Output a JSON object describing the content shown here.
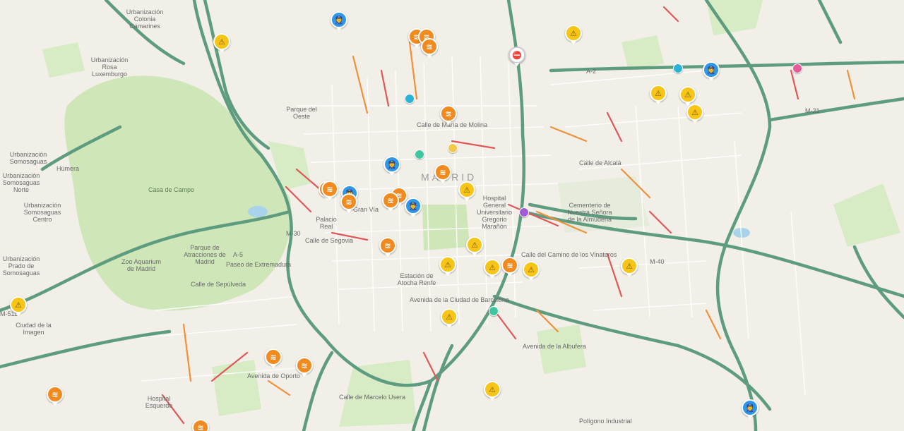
{
  "map": {
    "colors": {
      "land": "#f2efe9",
      "park": "#cfe6b8",
      "highway": "#5e9c7f",
      "jam_red": "#e05757",
      "jam_orange": "#f0913a",
      "street": "#ffffff"
    },
    "district_label": "MADRID",
    "labels": [
      {
        "id": "urb-colonia-camarines",
        "text": "Urbanización Colonia Camarines"
      },
      {
        "id": "urb-rosa-luxemburgo",
        "text": "Urbanización Rosa Luxemburgo"
      },
      {
        "id": "urb-somosaguas",
        "text": "Urbanización Somosaguas"
      },
      {
        "id": "humera",
        "text": "Húmera"
      },
      {
        "id": "urb-somosaguas-norte",
        "text": "Urbanización Somosaguas Norte"
      },
      {
        "id": "urb-somosaguas-centro",
        "text": "Urbanización Somosaguas Centro"
      },
      {
        "id": "urb-prado-somosaguas",
        "text": "Urbanización Prado de Somosaguas"
      },
      {
        "id": "ciudad-imagen",
        "text": "Ciudad de la Imagen"
      },
      {
        "id": "casa-campo",
        "text": "Casa de Campo"
      },
      {
        "id": "parque-atracciones",
        "text": "Parque de Atracciones de Madrid"
      },
      {
        "id": "zoo-aquarium",
        "text": "Zoo Aquarium de Madrid"
      },
      {
        "id": "palacio-real",
        "text": "Palacio Real"
      },
      {
        "id": "cementerio-almudena",
        "text": "Cementerio de Nuestra Señora de la Almudena"
      },
      {
        "id": "hospital-maranon",
        "text": "Hospital General Universitario Gregorio Marañón"
      },
      {
        "id": "estacion-atocha",
        "text": "Estación de Atocha Renfe"
      },
      {
        "id": "poligono-industrial",
        "text": "Polígono Industrial"
      },
      {
        "id": "calle-alcala",
        "text": "Calle de Alcalá"
      },
      {
        "id": "gran-via",
        "text": "Gran Vía"
      },
      {
        "id": "calle-segovia",
        "text": "Calle de Segovia"
      },
      {
        "id": "calle-sepulveda",
        "text": "Calle de Sepúlveda"
      },
      {
        "id": "paseo-extremadura",
        "text": "Paseo de Extremadura"
      },
      {
        "id": "calle-maria-molina",
        "text": "Calle de María de Molina"
      },
      {
        "id": "avenida-ciudad-barcelona",
        "text": "Avenida de la Ciudad de Barcelona"
      },
      {
        "id": "avenida-albufera",
        "text": "Avenida de la Albufera"
      },
      {
        "id": "calle-camino-vinateros",
        "text": "Calle del Camino de los Vinateros"
      },
      {
        "id": "avenida-oporto",
        "text": "Avenida de Oporto"
      },
      {
        "id": "calle-marcelo-usera",
        "text": "Calle de Marcelo Usera"
      },
      {
        "id": "m30",
        "text": "M-30"
      },
      {
        "id": "m40",
        "text": "M-40"
      },
      {
        "id": "a5",
        "text": "A-5"
      },
      {
        "id": "a2",
        "text": "A-2"
      },
      {
        "id": "m21",
        "text": "M-21"
      },
      {
        "id": "m511",
        "text": "M-511"
      },
      {
        "id": "hospital-esquerdo",
        "text": "Hospital Esquerdo"
      },
      {
        "id": "parque-oeste",
        "text": "Parque del Oeste"
      }
    ],
    "markers": [
      {
        "type": "police",
        "icon": "police-icon"
      },
      {
        "type": "hazard",
        "icon": "hazard-icon"
      },
      {
        "type": "jam",
        "icon": "traffic-jam-icon"
      },
      {
        "type": "jam",
        "icon": "traffic-jam-icon"
      },
      {
        "type": "jam",
        "icon": "traffic-jam-icon"
      },
      {
        "type": "hazard",
        "icon": "hazard-icon"
      },
      {
        "type": "closure",
        "icon": "road-closure-icon"
      },
      {
        "type": "police",
        "icon": "police-icon"
      },
      {
        "type": "hazard",
        "icon": "hazard-icon"
      },
      {
        "type": "hazard",
        "icon": "hazard-icon"
      },
      {
        "type": "hazard",
        "icon": "hazard-icon"
      },
      {
        "type": "jam",
        "icon": "traffic-jam-icon"
      },
      {
        "type": "police",
        "icon": "police-icon"
      },
      {
        "type": "jam",
        "icon": "traffic-jam-icon"
      },
      {
        "type": "hazard",
        "icon": "hazard-icon"
      },
      {
        "type": "jam",
        "icon": "traffic-jam-icon"
      },
      {
        "type": "jam",
        "icon": "traffic-jam-icon"
      },
      {
        "type": "police",
        "icon": "police-icon"
      },
      {
        "type": "jam",
        "icon": "traffic-jam-icon"
      },
      {
        "type": "jam",
        "icon": "traffic-jam-icon"
      },
      {
        "type": "jam",
        "icon": "traffic-jam-icon"
      },
      {
        "type": "police",
        "icon": "police-icon"
      },
      {
        "type": "hazard",
        "icon": "hazard-icon"
      },
      {
        "type": "jam",
        "icon": "traffic-jam-icon"
      },
      {
        "type": "hazard",
        "icon": "hazard-icon"
      },
      {
        "type": "hazard",
        "icon": "hazard-icon"
      },
      {
        "type": "jam",
        "icon": "traffic-jam-icon"
      },
      {
        "type": "hazard",
        "icon": "hazard-icon"
      },
      {
        "type": "hazard",
        "icon": "hazard-icon"
      },
      {
        "type": "hazard",
        "icon": "hazard-icon"
      },
      {
        "type": "hazard",
        "icon": "hazard-icon"
      },
      {
        "type": "jam",
        "icon": "traffic-jam-icon"
      },
      {
        "type": "jam",
        "icon": "traffic-jam-icon"
      },
      {
        "type": "jam",
        "icon": "traffic-jam-icon"
      },
      {
        "type": "hazard",
        "icon": "hazard-icon"
      },
      {
        "type": "police",
        "icon": "police-icon"
      },
      {
        "type": "jam",
        "icon": "traffic-jam-icon"
      }
    ],
    "wazers": [
      {
        "color": "#2bb3d6"
      },
      {
        "color": "#3ec6a0"
      },
      {
        "color": "#f2c94c"
      },
      {
        "color": "#a25bd6"
      },
      {
        "color": "#2bb3d6"
      },
      {
        "color": "#e85a9a"
      },
      {
        "color": "#3ec6a0"
      }
    ]
  }
}
